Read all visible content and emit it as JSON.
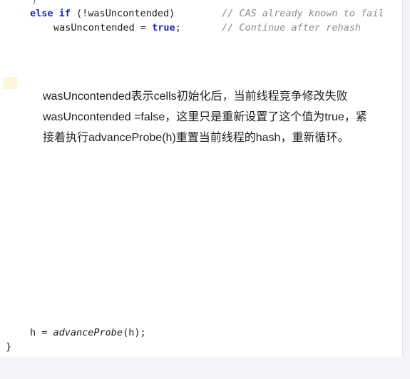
{
  "code": {
    "line1": {
      "else": "else",
      "if": "if",
      "rest": " (!wasUncontended)",
      "comment": "// CAS already known to fail"
    },
    "line2": {
      "var": "wasUncontended = ",
      "value": "true",
      "semi": ";",
      "comment": "// Continue after rehash"
    },
    "line3": {
      "prefix": "h = ",
      "method": "advanceProbe",
      "suffix": "(h);"
    },
    "closing_brace": "}"
  },
  "annotation": {
    "line1": "wasUncontended表示cells初始化后，当前线程竞争修改失败",
    "line2": "wasUncontended =false，这里只是重新设置了这个值为true，紧",
    "line3": "接着执行advanceProbe(h)重置当前线程的hash，重新循环。"
  }
}
